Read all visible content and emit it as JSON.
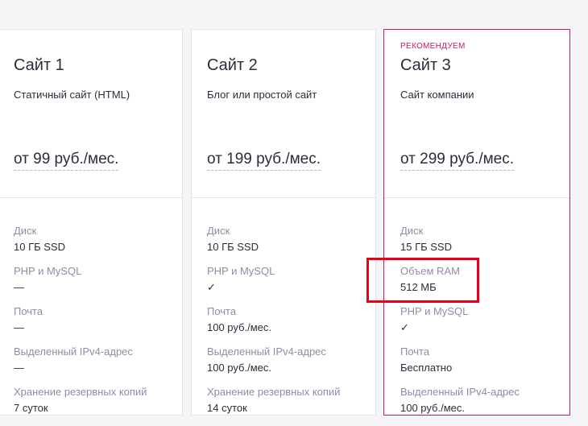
{
  "plans": [
    {
      "title": "Сайт 1",
      "subtitle": "Статичный сайт (HTML)",
      "price": "от 99 руб./мес.",
      "features": [
        {
          "label": "Диск",
          "value": "10 ГБ SSD"
        },
        {
          "label": "PHP и MySQL",
          "value": "—"
        },
        {
          "label": "Почта",
          "value": "—"
        },
        {
          "label": "Выделенный IPv4-адрес",
          "value": "—"
        },
        {
          "label": "Хранение резервных копий",
          "value": "7 суток"
        }
      ]
    },
    {
      "title": "Сайт 2",
      "subtitle": "Блог или простой сайт",
      "price": "от 199 руб./мес.",
      "features": [
        {
          "label": "Диск",
          "value": "10 ГБ SSD"
        },
        {
          "label": "PHP и MySQL",
          "value": "✓"
        },
        {
          "label": "Почта",
          "value": "100 руб./мес."
        },
        {
          "label": "Выделенный IPv4-адрес",
          "value": "100 руб./мес."
        },
        {
          "label": "Хранение резервных копий",
          "value": "14 суток"
        }
      ]
    },
    {
      "badge": "РЕКОМЕНДУЕМ",
      "title": "Сайт 3",
      "subtitle": "Сайт компании",
      "price": "от 299 руб./мес.",
      "features": [
        {
          "label": "Диск",
          "value": "15 ГБ SSD"
        },
        {
          "label": "Объем RAM",
          "value": "512 МБ"
        },
        {
          "label": "PHP и MySQL",
          "value": "✓"
        },
        {
          "label": "Почта",
          "value": "Бесплатно"
        },
        {
          "label": "Выделенный IPv4-адрес",
          "value": "100 руб./мес."
        }
      ]
    }
  ],
  "colors": {
    "accent": "#c8186a",
    "highlight": "#e8001c",
    "label": "#8a8fa5",
    "text": "#2b2d3a"
  }
}
